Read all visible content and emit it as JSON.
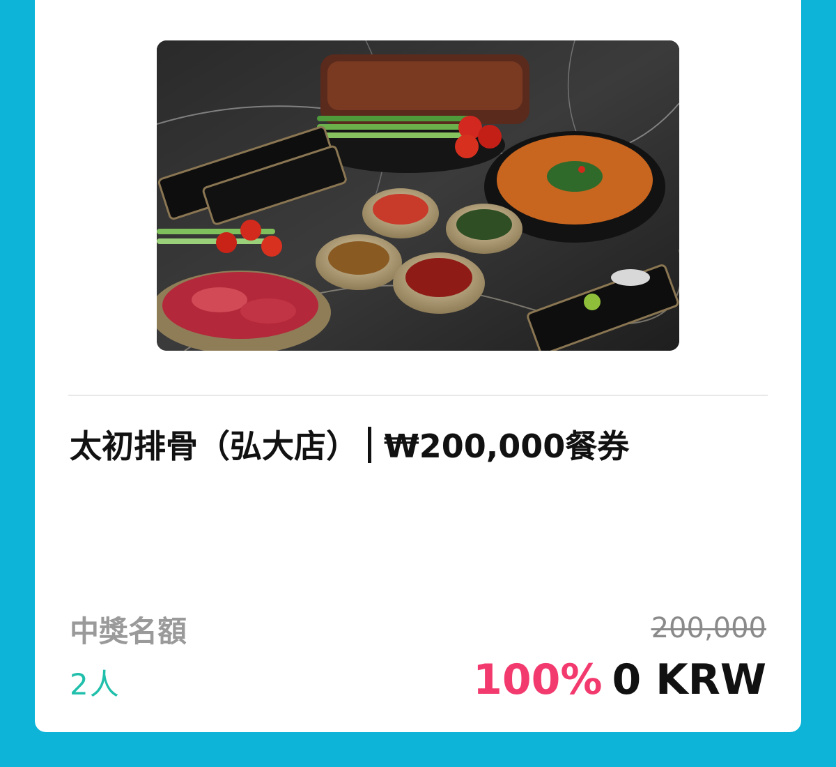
{
  "product": {
    "name": "太初排骨（弘大店）",
    "voucher": "₩200,000餐券",
    "image_alt": "Korean BBQ set with marinated beef, banchan side dishes and stew on marble table"
  },
  "winners": {
    "label": "中獎名額",
    "count": "2人"
  },
  "price": {
    "original": "200,000",
    "discount": "100%",
    "final": "0 KRW"
  },
  "colors": {
    "frame": "#0db4d8",
    "discount": "#f23a6e",
    "winners": "#1fbfab"
  }
}
